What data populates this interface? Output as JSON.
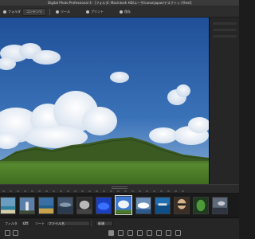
{
  "window": {
    "title": "Digital Photo Professional 4 - [フォルダ: Macintosh HD/ユーザ/canonjapan/デスクトップ/test]"
  },
  "toolbar": {
    "items": [
      {
        "label": "フォルダ",
        "icon": "folder-icon"
      },
      {
        "label": "コンテンツ"
      },
      {
        "label": "ツール",
        "icon": "tool-icon"
      },
      {
        "label": "プリント",
        "icon": "print-icon"
      },
      {
        "label": "保存",
        "icon": "save-icon"
      }
    ]
  },
  "viewer": {
    "image_subject": "landscape-photo",
    "sky_color": "#2d62a8",
    "grass_color": "#4a7a28"
  },
  "filmstrip": {
    "thumbnails": [
      {
        "name": "beach"
      },
      {
        "name": "lighthouse"
      },
      {
        "name": "coast"
      },
      {
        "name": "coast-dusk"
      },
      {
        "name": "light-sky"
      },
      {
        "name": "blue-sky",
        "selected": true
      },
      {
        "name": "cloud"
      },
      {
        "name": "sea"
      },
      {
        "name": "portrait"
      },
      {
        "name": "leaf"
      },
      {
        "name": "dusk"
      }
    ]
  },
  "bottombar": {
    "filter_label": "フィルタ",
    "filter_value": "Off",
    "sort_label": "ソート",
    "sort_value": "ファイル名",
    "order_value": "昇順"
  }
}
